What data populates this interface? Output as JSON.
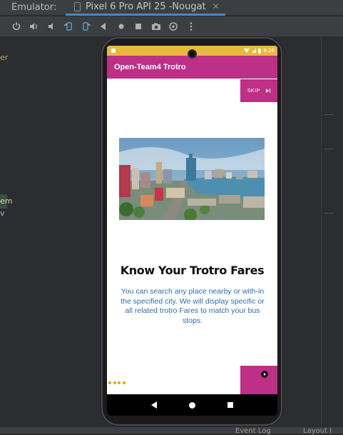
{
  "ide": {
    "emulator_label": "Emulator:",
    "device_tab": "Pixel 6 Pro API 25 -Nougat",
    "close_glyph": "✕",
    "left_fragments": [
      "er",
      "em",
      "v"
    ],
    "status_fragments": [
      "Event Log",
      "Layout I"
    ]
  },
  "status_bar": {
    "time": "9:28"
  },
  "app": {
    "title": "Open-Team4 Trotro",
    "skip_label": "SKIP",
    "heading": "Know Your Trotro Fares",
    "description": "You can search any place nearby or with-in the specified city. We will display specific or all related trotro Fares to match your bus stops.",
    "page_indicator_count": 4,
    "accent_color": "#be2f87",
    "statusbar_color": "#e8b93e",
    "dot_color": "#e8a400",
    "description_color": "#2d6dab"
  }
}
